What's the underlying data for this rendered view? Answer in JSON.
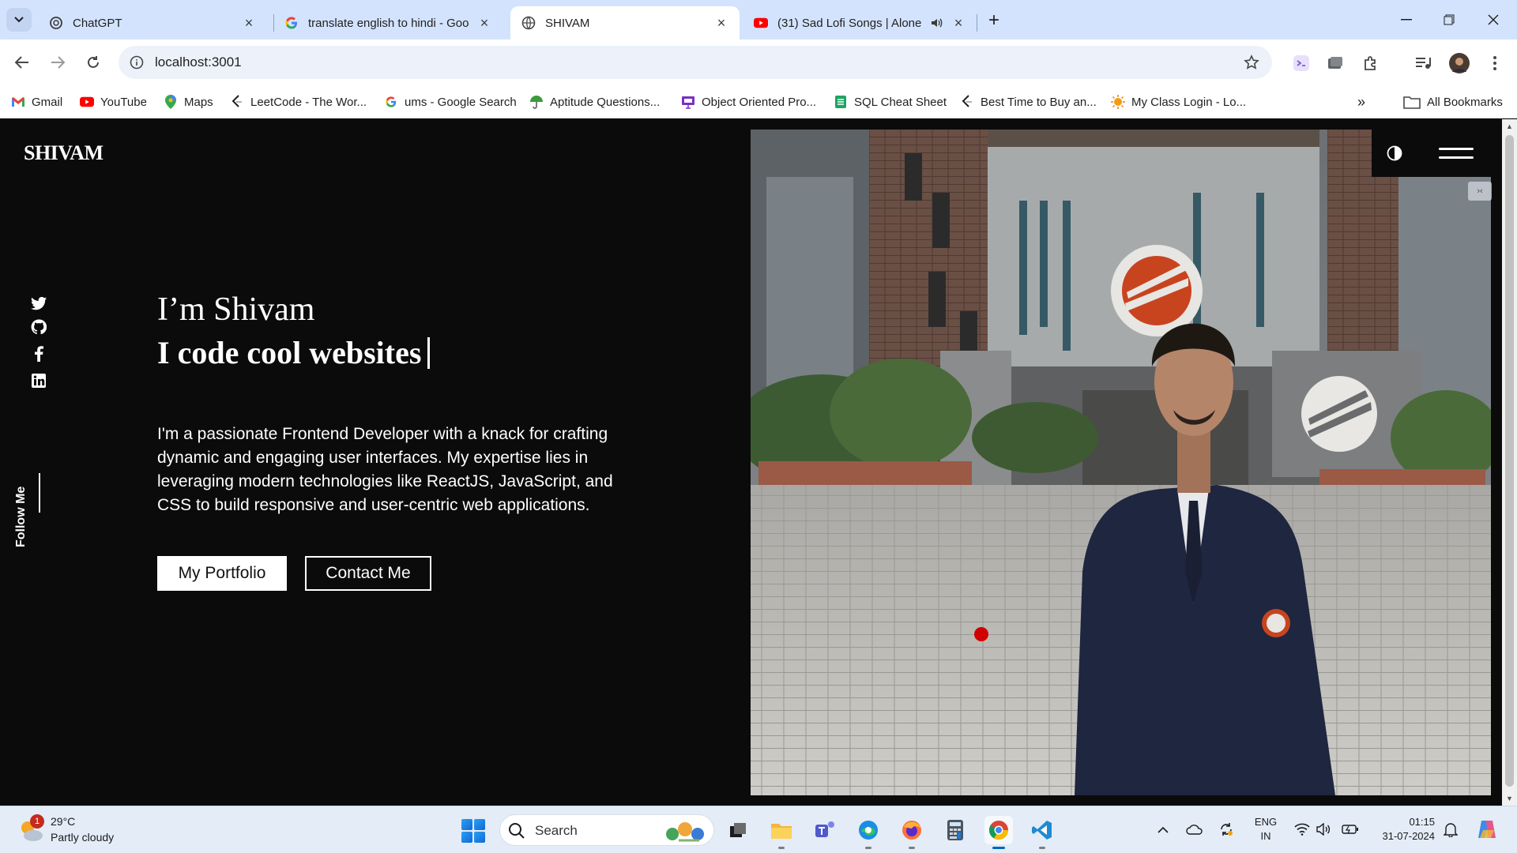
{
  "browser": {
    "tabs": [
      {
        "title": "ChatGPT"
      },
      {
        "title": "translate english to hindi - Goo"
      },
      {
        "title": "SHIVAM"
      },
      {
        "title": "(31) Sad Lofi Songs | Alone"
      }
    ],
    "url": "localhost:3001",
    "bookmarks": [
      {
        "label": "Gmail"
      },
      {
        "label": "YouTube"
      },
      {
        "label": "Maps"
      },
      {
        "label": "LeetCode - The Wor..."
      },
      {
        "label": "ums - Google Search"
      },
      {
        "label": "Aptitude Questions..."
      },
      {
        "label": "Object Oriented Pro..."
      },
      {
        "label": "SQL Cheat Sheet"
      },
      {
        "label": "Best Time to Buy an..."
      },
      {
        "label": "My Class Login - Lo..."
      }
    ],
    "all_bookmarks": "All Bookmarks"
  },
  "page": {
    "brand": "SHIVAM",
    "intro": "I’m Shivam",
    "tagline": "I code cool websites",
    "description": "I'm a passionate Frontend Developer with a knack for crafting dynamic and engaging user interfaces. My expertise lies in leveraging modern technologies like ReactJS, JavaScript, and CSS to build responsive and user-centric web applications.",
    "buttons": {
      "portfolio": "My Portfolio",
      "contact": "Contact Me"
    },
    "follow_label": "Follow Me",
    "social_icons": [
      "twitter-icon",
      "github-icon",
      "facebook-icon",
      "linkedin-icon"
    ],
    "colors": {
      "background": "#0b0b0b",
      "text": "#ffffff",
      "accent_dot": "#d00000"
    }
  },
  "taskbar": {
    "weather": {
      "temp": "29°C",
      "desc": "Partly cloudy",
      "badge": "1"
    },
    "search_label": "Search",
    "language": {
      "line1": "ENG",
      "line2": "IN"
    },
    "time": "01:15",
    "date": "31-07-2024"
  }
}
